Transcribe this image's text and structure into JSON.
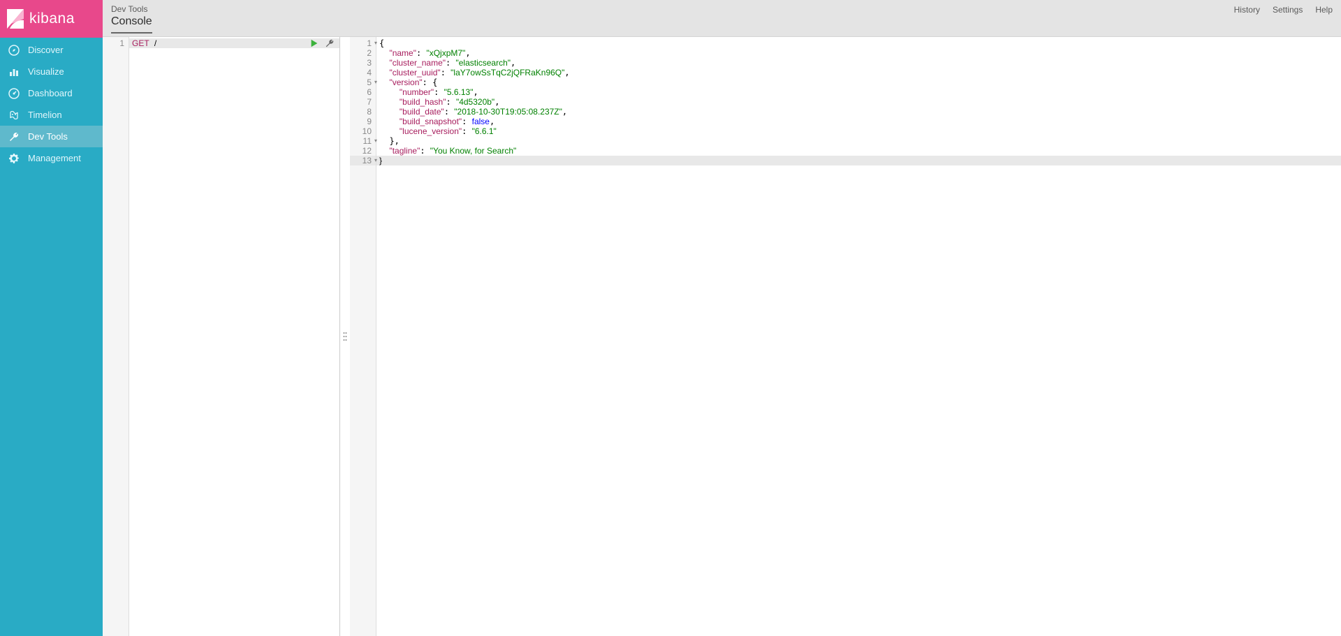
{
  "brand": {
    "name": "kibana"
  },
  "nav": {
    "items": [
      {
        "id": "discover",
        "label": "Discover",
        "icon": "compass-icon"
      },
      {
        "id": "visualize",
        "label": "Visualize",
        "icon": "bar-chart-icon"
      },
      {
        "id": "dashboard",
        "label": "Dashboard",
        "icon": "gauge-icon"
      },
      {
        "id": "timelion",
        "label": "Timelion",
        "icon": "timelion-icon"
      },
      {
        "id": "devtools",
        "label": "Dev Tools",
        "icon": "wrench-icon",
        "active": true
      },
      {
        "id": "management",
        "label": "Management",
        "icon": "gear-icon"
      }
    ]
  },
  "header": {
    "breadcrumb": "Dev Tools",
    "tab": "Console",
    "links": {
      "history": "History",
      "settings": "Settings",
      "help": "Help"
    }
  },
  "request": {
    "line_no": "1",
    "method": "GET",
    "path": "/"
  },
  "response": {
    "lines": [
      {
        "n": "1",
        "fold": true,
        "t": "{"
      },
      {
        "n": "2",
        "fold": false,
        "t": "  \"name\": \"xQjxpM7\","
      },
      {
        "n": "3",
        "fold": false,
        "t": "  \"cluster_name\": \"elasticsearch\","
      },
      {
        "n": "4",
        "fold": false,
        "t": "  \"cluster_uuid\": \"laY7owSsTqC2jQFRaKn96Q\","
      },
      {
        "n": "5",
        "fold": true,
        "t": "  \"version\": {"
      },
      {
        "n": "6",
        "fold": false,
        "t": "    \"number\": \"5.6.13\","
      },
      {
        "n": "7",
        "fold": false,
        "t": "    \"build_hash\": \"4d5320b\","
      },
      {
        "n": "8",
        "fold": false,
        "t": "    \"build_date\": \"2018-10-30T19:05:08.237Z\","
      },
      {
        "n": "9",
        "fold": false,
        "t": "    \"build_snapshot\": false,"
      },
      {
        "n": "10",
        "fold": false,
        "t": "    \"lucene_version\": \"6.6.1\""
      },
      {
        "n": "11",
        "fold": true,
        "t": "  },"
      },
      {
        "n": "12",
        "fold": false,
        "t": "  \"tagline\": \"You Know, for Search\""
      },
      {
        "n": "13",
        "fold": true,
        "t": "}",
        "last": true
      }
    ]
  }
}
